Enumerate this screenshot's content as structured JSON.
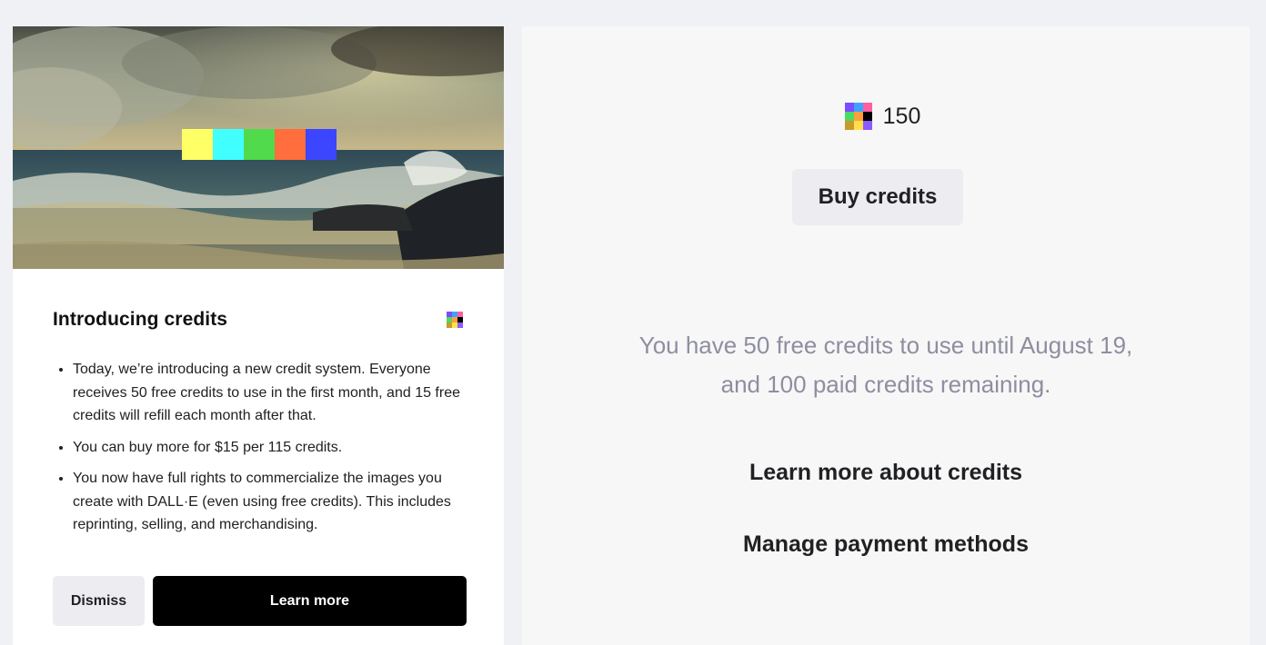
{
  "colors": {
    "page_background": "#eff1f5",
    "card_background": "#ffffff",
    "panel_background": "#f7f7f8",
    "primary_button": "#000000",
    "secondary_button": "#ececf1",
    "muted_text": "#8e8ea0"
  },
  "intro_card": {
    "hero_image": "seascape-painting",
    "logo_swatches": [
      "#ffff66",
      "#42ffff",
      "#51da4c",
      "#ff6e3c",
      "#3c46ff"
    ],
    "title": "Introducing credits",
    "title_icon": "credits-grid-icon",
    "bullets": [
      "Today, we’re introducing a new credit system. Everyone receives 50 free credits to use in the first month, and 15 free credits will refill each month after that.",
      "You can buy more for $15 per 115 credits.",
      "You now have full rights to commercialize the images you create with DALL·E (even using free credits). This includes reprinting, selling, and merchandising."
    ],
    "dismiss_label": "Dismiss",
    "learn_more_label": "Learn more"
  },
  "credits_panel": {
    "icon": "credits-grid-icon",
    "credit_count": "150",
    "buy_label": "Buy credits",
    "balance_line1": "You have 50 free credits to use until August 19,",
    "balance_line2": "and 100 paid credits remaining.",
    "learn_link": "Learn more about credits",
    "manage_link": "Manage payment methods"
  },
  "credit_icon_colors": [
    "#7b4dff",
    "#3da3ff",
    "#ff5fa2",
    "#4cd964",
    "#ff9f3c",
    "#000000",
    "#c79a2a",
    "#ffe04a",
    "#8a5cff"
  ]
}
